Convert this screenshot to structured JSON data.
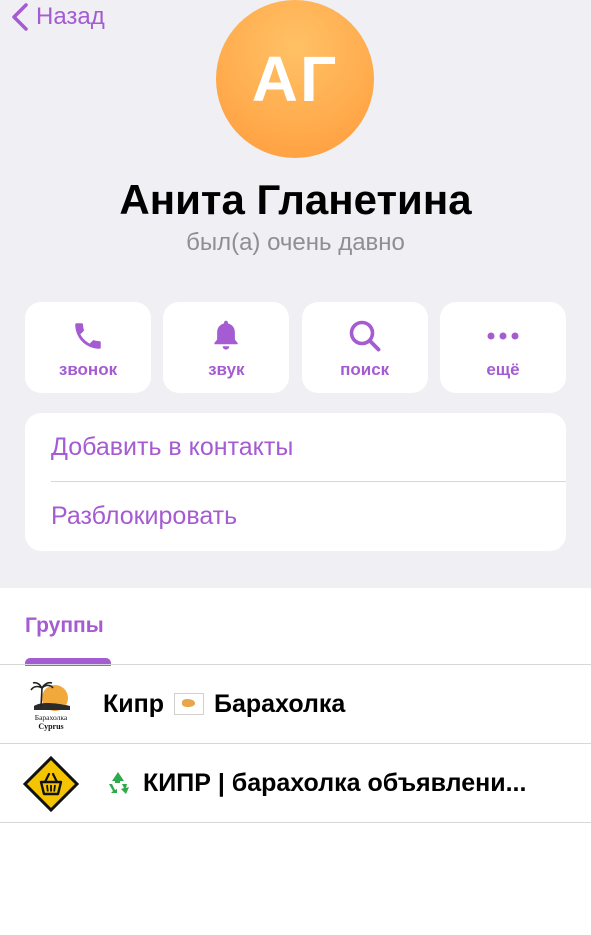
{
  "nav": {
    "back_label": "Назад"
  },
  "profile": {
    "initials": "АГ",
    "name": "Анита Гланетина",
    "status": "был(а) очень давно",
    "avatar_color": "#ffad4f"
  },
  "actions": [
    {
      "icon": "phone-icon",
      "label": "звонок"
    },
    {
      "icon": "bell-icon",
      "label": "звук"
    },
    {
      "icon": "search-icon",
      "label": "поиск"
    },
    {
      "icon": "more-icon",
      "label": "ещё"
    }
  ],
  "menu": {
    "add_contact": "Добавить в контакты",
    "unblock": "Разблокировать"
  },
  "tabs": {
    "groups": "Группы"
  },
  "groups": [
    {
      "icon": "baraholka-cyprus-logo",
      "name_before": "Кипр",
      "flag": "cyprus-flag",
      "name_after": "Барахолка",
      "logo_text_1": "Барахолка",
      "logo_text_2": "Cyprus"
    },
    {
      "icon": "basket-sign-logo",
      "prefix_icon": "recycle-icon",
      "name": "КИПР | барахолка объявлени..."
    }
  ],
  "colors": {
    "accent": "#a55bd1",
    "background": "#efeff4",
    "secondary_text": "#8e8e93"
  }
}
